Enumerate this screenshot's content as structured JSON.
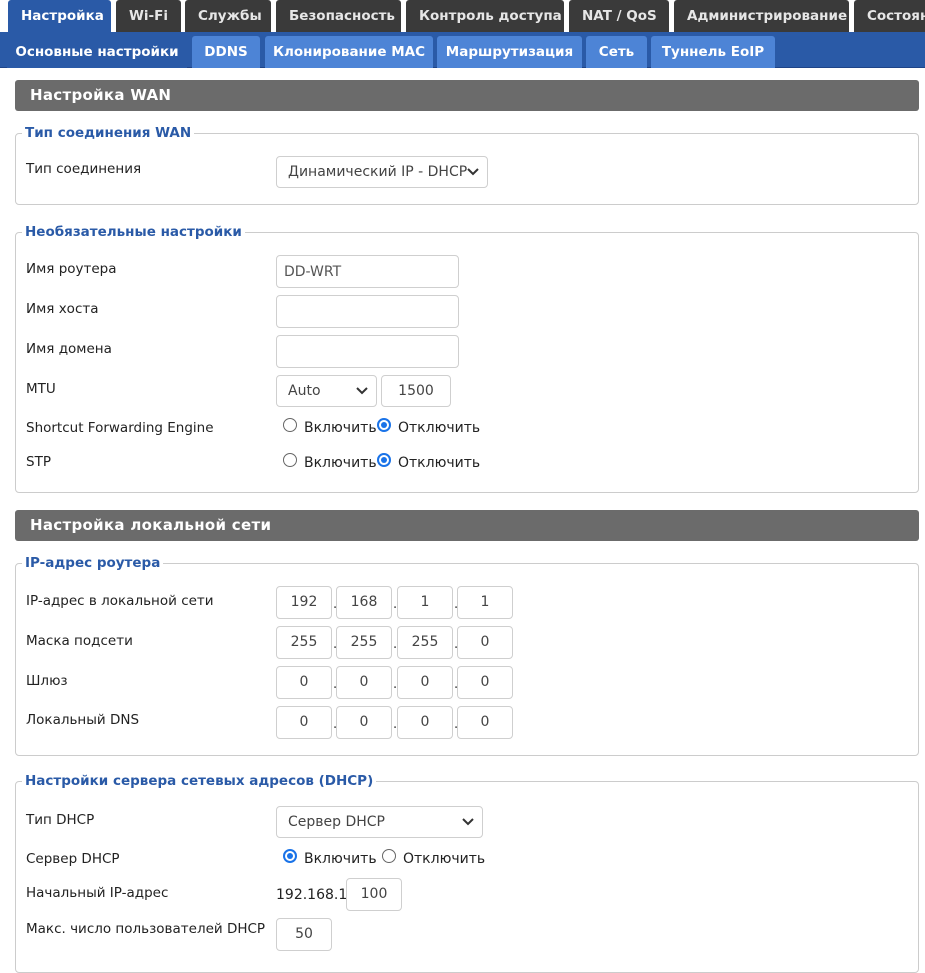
{
  "nav": {
    "tabs": [
      "Настройка",
      "Wi-Fi",
      "Службы",
      "Безопасность",
      "Контроль доступа",
      "NAT / QoS",
      "Администрирование",
      "Состояние"
    ],
    "active": "Настройка"
  },
  "subnav": {
    "tabs": [
      "Основные настройки",
      "DDNS",
      "Клонирование MAC",
      "Маршрутизация",
      "Сеть",
      "Туннель EoIP"
    ],
    "active": "Основные настройки"
  },
  "wan": {
    "header": "Настройка WAN",
    "conn_legend": "Тип соединения WAN",
    "conn_type_label": "Тип соединения",
    "conn_type_value": "Динамический IP - DHCP",
    "opt_legend": "Необязательные настройки",
    "router_name_label": "Имя роутера",
    "router_name_value": "DD-WRT",
    "host_name_label": "Имя хоста",
    "host_name_value": "",
    "domain_name_label": "Имя домена",
    "domain_name_value": "",
    "mtu_label": "MTU",
    "mtu_mode": "Auto",
    "mtu_value": "1500",
    "sfe_label": "Shortcut Forwarding Engine",
    "sfe_enable": "Включить",
    "sfe_disable": "Отключить",
    "sfe_selected": "disable",
    "stp_label": "STP",
    "stp_enable": "Включить",
    "stp_disable": "Отключить",
    "stp_selected": "disable"
  },
  "lan": {
    "header": "Настройка локальной сети",
    "ip_legend": "IP-адрес роутера",
    "local_ip_label": "IP-адрес в локальной сети",
    "local_ip": [
      "192",
      "168",
      "1",
      "1"
    ],
    "mask_label": "Маска подсети",
    "mask": [
      "255",
      "255",
      "255",
      "0"
    ],
    "gateway_label": "Шлюз",
    "gateway": [
      "0",
      "0",
      "0",
      "0"
    ],
    "dns_label": "Локальный DNS",
    "dns": [
      "0",
      "0",
      "0",
      "0"
    ]
  },
  "dhcp": {
    "legend": "Настройки сервера сетевых адресов (DHCP)",
    "type_label": "Тип DHCP",
    "type_value": "Сервер DHCP",
    "server_label": "Сервер DHCP",
    "server_enable": "Включить",
    "server_disable": "Отключить",
    "server_selected": "enable",
    "start_ip_label": "Начальный IP-адрес",
    "start_ip_prefix": "192.168.1.",
    "start_ip_value": "100",
    "max_users_label": "Макс. число пользователей DHCP",
    "max_users_value": "50"
  },
  "icons": {
    "dropdown": "chevron-down-icon"
  }
}
